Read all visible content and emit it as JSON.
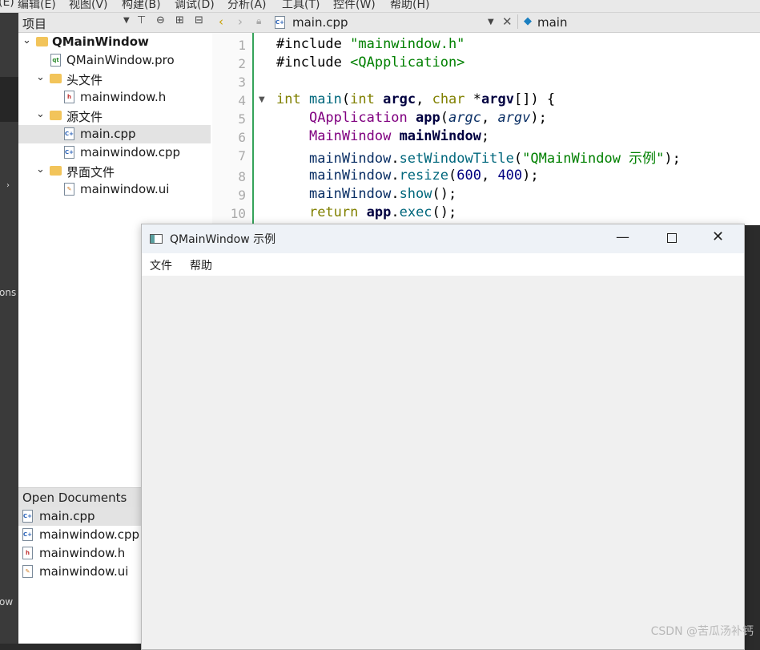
{
  "menubar": {
    "items": [
      "(E)",
      "编辑(E)",
      "视图(V)",
      "构建(B)",
      "调试(D)",
      "分析(A)",
      "工具(T)",
      "控件(W)",
      "帮助(H)"
    ]
  },
  "modestrip": {
    "label1": "ons",
    "label2": "ow"
  },
  "project_pane": {
    "title": "项目",
    "tree": [
      {
        "label": "QMainWindow",
        "bold": true
      },
      {
        "label": "QMainWindow.pro"
      },
      {
        "label": "头文件"
      },
      {
        "label": "mainwindow.h"
      },
      {
        "label": "源文件"
      },
      {
        "label": "main.cpp",
        "selected": true
      },
      {
        "label": "mainwindow.cpp"
      },
      {
        "label": "界面文件"
      },
      {
        "label": "mainwindow.ui"
      }
    ]
  },
  "open_documents": {
    "title": "Open Documents",
    "items": [
      "main.cpp",
      "mainwindow.cpp",
      "mainwindow.h",
      "mainwindow.ui"
    ]
  },
  "editor": {
    "file": "main.cpp",
    "symbol": "main",
    "line_numbers": [
      "1",
      "2",
      "3",
      "4",
      "5",
      "6",
      "7",
      "8",
      "9",
      "10"
    ],
    "lines": [
      "#include \"mainwindow.h\"",
      "#include <QApplication>",
      "",
      "int main(int argc, char *argv[]) {",
      "    QApplication app(argc, argv);",
      "    MainWindow mainWindow;",
      "    mainWindow.setWindowTitle(\"QMainWindow 示例\");",
      "    mainWindow.resize(600, 400);",
      "    mainWindow.show();",
      "    return app.exec();"
    ]
  },
  "app_window": {
    "title": "QMainWindow 示例",
    "menu": [
      "文件",
      "帮助"
    ]
  },
  "watermark": "CSDN @苦瓜汤补钙"
}
